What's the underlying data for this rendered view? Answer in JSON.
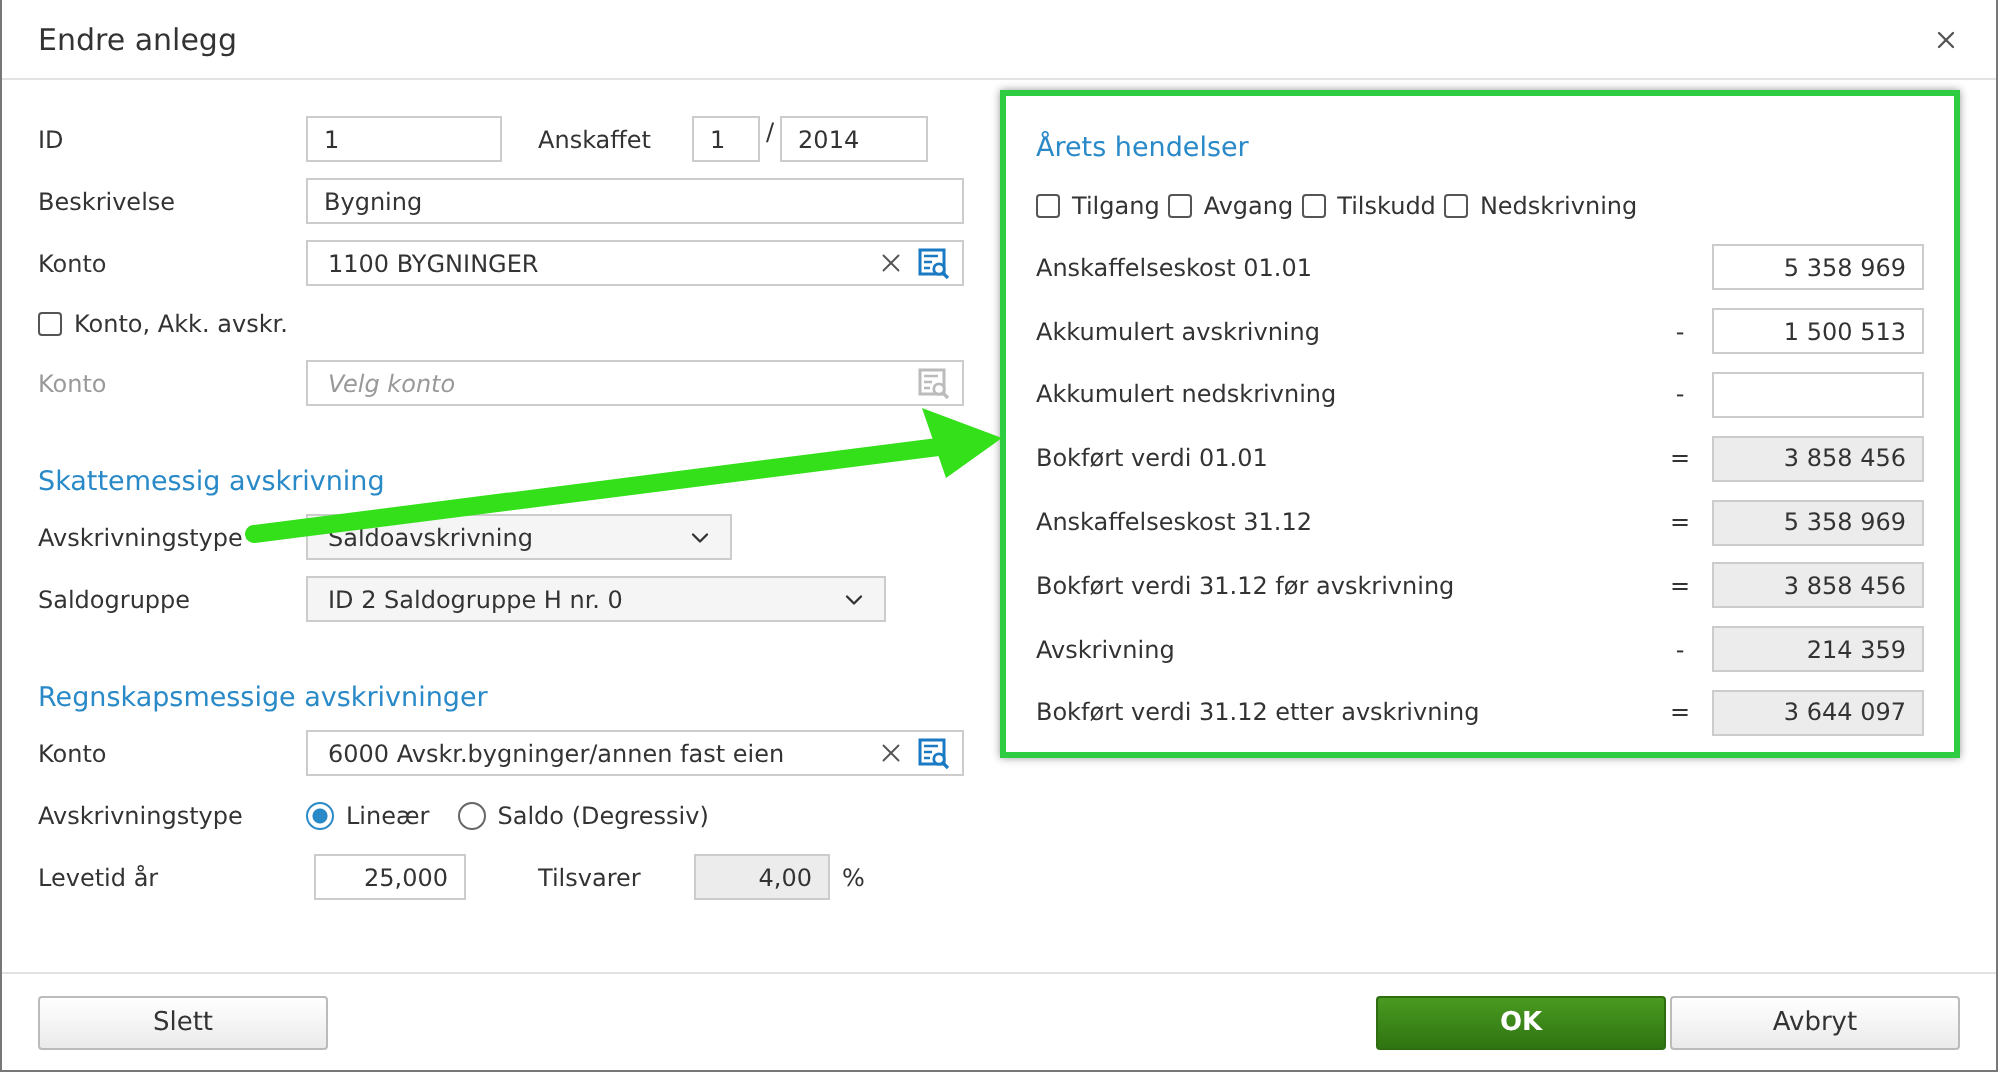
{
  "window": {
    "title": "Endre anlegg"
  },
  "general": {
    "id": {
      "label": "ID",
      "value": "1"
    },
    "anskaffet": {
      "label": "Anskaffet",
      "month": "1",
      "separator": "/",
      "year": "2014"
    },
    "beskrivelse": {
      "label": "Beskrivelse",
      "value": "Bygning"
    },
    "konto": {
      "label": "Konto",
      "value": "1100 BYGNINGER",
      "disabled": false
    },
    "akk_checkbox": {
      "label": "Konto, Akk. avskr.",
      "checked": false
    },
    "akk_konto": {
      "label": "Konto",
      "placeholder": "Velg konto",
      "disabled": true
    }
  },
  "tax": {
    "heading": "Skattemessig avskrivning",
    "avskrivningstype": {
      "label": "Avskrivningstype",
      "value": "Saldoavskrivning"
    },
    "saldogruppe": {
      "label": "Saldogruppe",
      "value": "ID 2 Saldogruppe H nr. 0"
    }
  },
  "accounting": {
    "heading": "Regnskapsmessige avskrivninger",
    "konto": {
      "label": "Konto",
      "value": "6000 Avskr.bygninger/annen fast eien",
      "disabled": false
    },
    "avskrivningstype": {
      "label": "Avskrivningstype",
      "options": [
        {
          "label": "Lineær",
          "selected": true
        },
        {
          "label": "Saldo (Degressiv)",
          "selected": false
        }
      ]
    },
    "levetid": {
      "label": "Levetid år",
      "value": "25,000"
    },
    "tilsvarer": {
      "label": "Tilsvarer",
      "value": "4,00",
      "unit": "%"
    }
  },
  "events": {
    "heading": "Årets hendelser",
    "checkboxes": [
      {
        "label": "Tilgang",
        "checked": false
      },
      {
        "label": "Avgang",
        "checked": false
      },
      {
        "label": "Tilskudd",
        "checked": false
      },
      {
        "label": "Nedskrivning",
        "checked": false
      }
    ],
    "rows": [
      {
        "label": "Anskaffelseskost 01.01",
        "value": "5 358 969",
        "readonly": false
      },
      {
        "label": "Akkumulert avskrivning",
        "operator": "-",
        "value": "1 500 513",
        "readonly": false
      },
      {
        "label": "Akkumulert nedskrivning",
        "operator": "-",
        "readonly": false
      },
      {
        "label": "Bokført verdi 01.01",
        "operator": "=",
        "value": "3 858 456",
        "readonly": true
      },
      {
        "label": "Anskaffelseskost 31.12",
        "operator": "=",
        "value": "5 358 969",
        "readonly": true
      },
      {
        "label": "Bokført verdi 31.12 før avskrivning",
        "operator": "=",
        "value": "3 858 456",
        "readonly": true
      },
      {
        "label": "Avskrivning",
        "operator": "-",
        "value": "214 359",
        "readonly": true
      },
      {
        "label": "Bokført verdi 31.12 etter avskrivning",
        "operator": "=",
        "value": "3 644 097",
        "readonly": true
      }
    ]
  },
  "footer": {
    "left_buttons": [
      {
        "label": "Slett",
        "kind": "default"
      }
    ],
    "right_buttons": [
      {
        "label": "OK",
        "kind": "primary"
      },
      {
        "label": "Avbryt",
        "kind": "default"
      }
    ]
  }
}
